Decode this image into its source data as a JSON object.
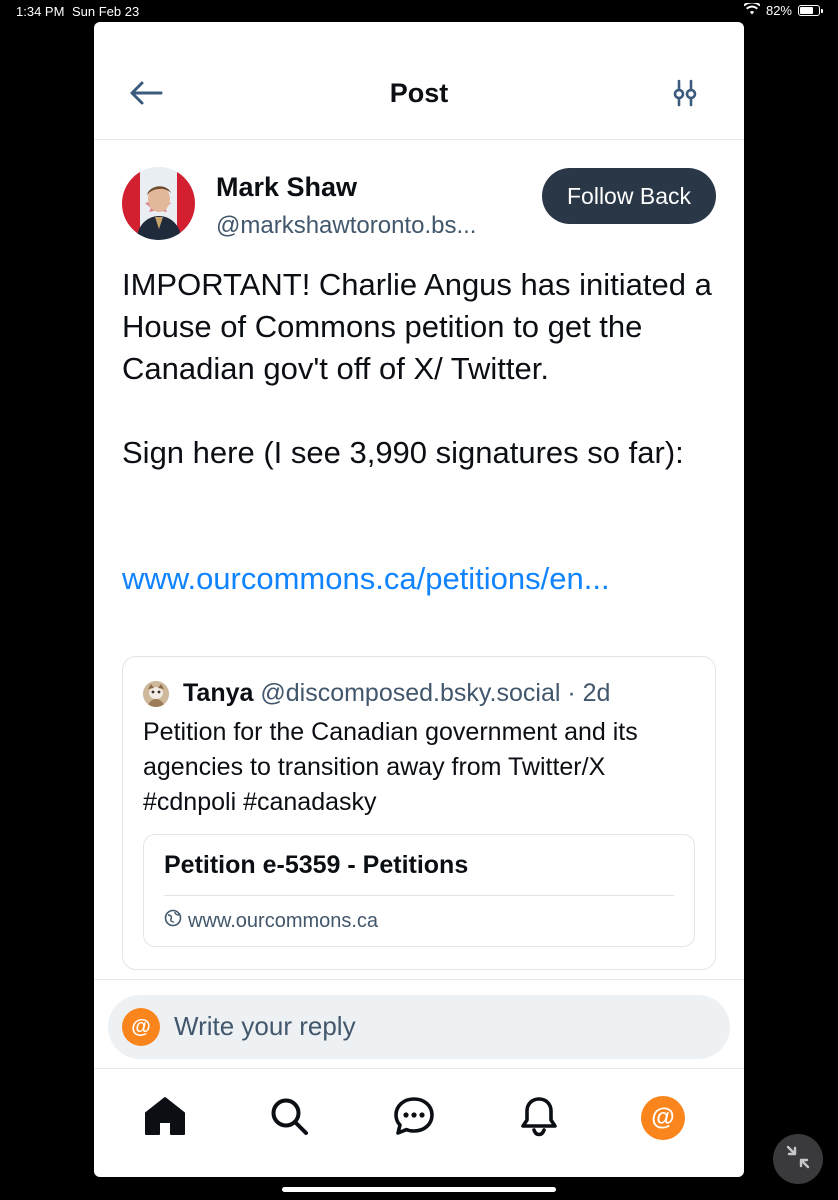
{
  "status_bar": {
    "time": "1:34 PM",
    "date": "Sun Feb 23",
    "battery": "82%",
    "battery_level": 0.82
  },
  "header": {
    "title": "Post",
    "back_icon": "arrow-left-icon",
    "settings_icon": "sliders-icon"
  },
  "post": {
    "author_name": "Mark Shaw",
    "author_handle": "@markshawtoronto.bs...",
    "follow_label": "Follow Back",
    "body_paragraphs": [
      "IMPORTANT! Charlie Angus has initiated a House of Commons petition to get the Canadian gov't off of X/ Twitter.",
      "Sign here (I see 3,990 signatures so far):"
    ],
    "link_text": "www.ourcommons.ca/petitions/en..."
  },
  "quote": {
    "author_name": "Tanya",
    "author_handle": "@discomposed.bsky.social",
    "separator": "·",
    "age": "2d",
    "text": "Petition for the Canadian government and its agencies to transition away from Twitter/X #cdnpoli #canadasky",
    "card": {
      "title": "Petition e-5359 - Petitions",
      "domain": "www.ourcommons.ca",
      "domain_icon": "globe-icon"
    }
  },
  "reply": {
    "placeholder": "Write your reply",
    "avatar_glyph": "@"
  },
  "tabs": [
    {
      "name": "home",
      "icon": "home-icon"
    },
    {
      "name": "search",
      "icon": "search-icon"
    },
    {
      "name": "chat",
      "icon": "chat-icon"
    },
    {
      "name": "notifications",
      "icon": "bell-icon"
    },
    {
      "name": "profile",
      "icon": "profile-avatar",
      "glyph": "@"
    }
  ],
  "colors": {
    "accent_link": "#1083fe",
    "follow_button": "#2a3746",
    "profile_orange": "#f9851c",
    "secondary_text": "#42576c"
  }
}
